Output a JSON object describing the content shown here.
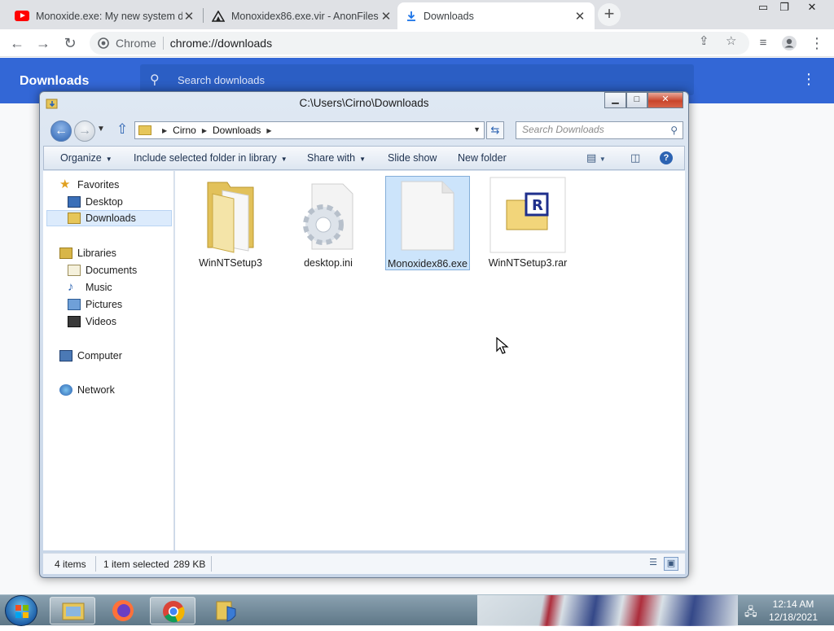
{
  "chrome": {
    "tabs": [
      {
        "title": "Monoxide.exe: My new system d",
        "icon": "youtube-icon"
      },
      {
        "title": "Monoxidex86.exe.vir - AnonFiles",
        "icon": "anonfiles-icon"
      },
      {
        "title": "Downloads",
        "icon": "download-icon"
      }
    ],
    "new_tab": "+",
    "omnibox": {
      "site_chip": "Chrome",
      "url": "chrome://downloads"
    }
  },
  "downloads_page": {
    "title": "Downloads",
    "search_placeholder": "Search downloads"
  },
  "explorer": {
    "title": "C:\\Users\\Cirno\\Downloads",
    "breadcrumb": [
      "Cirno",
      "Downloads"
    ],
    "search_placeholder": "Search Downloads",
    "commands": {
      "organize": "Organize",
      "include_library": "Include selected folder in library",
      "share_with": "Share with",
      "slide_show": "Slide show",
      "new_folder": "New folder"
    },
    "nav": {
      "favorites": "Favorites",
      "desktop": "Desktop",
      "downloads": "Downloads",
      "libraries": "Libraries",
      "documents": "Documents",
      "music": "Music",
      "pictures": "Pictures",
      "videos": "Videos",
      "computer": "Computer",
      "network": "Network"
    },
    "files": [
      {
        "name": "WinNTSetup3",
        "type": "folder"
      },
      {
        "name": "desktop.ini",
        "type": "settings"
      },
      {
        "name": "Monoxidex86.exe",
        "type": "exe",
        "selected": true
      },
      {
        "name": "WinNTSetup3.rar",
        "type": "rar"
      }
    ],
    "status": {
      "item_count": "4 items",
      "selected": "1 item selected",
      "size": "289 KB"
    }
  },
  "taskbar": {
    "time": "12:14 AM",
    "date": "12/18/2021"
  },
  "colors": {
    "chrome_blue": "#3367d6",
    "selection": "#cce4fb",
    "folder_yellow": "#f2d57a"
  }
}
